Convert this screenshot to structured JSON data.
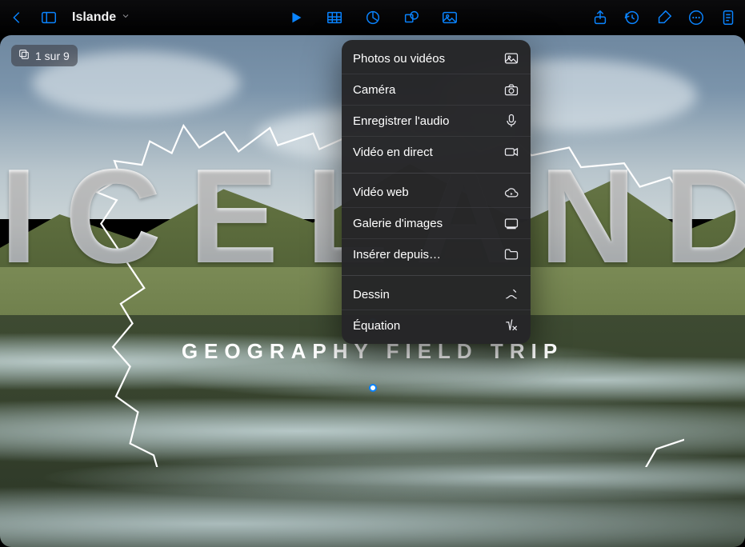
{
  "header": {
    "doc_title": "Islande"
  },
  "badge": {
    "label": "1 sur 9"
  },
  "slide": {
    "title": "ICELAND",
    "subtitle": "GEOGRAPHY FIELD TRIP"
  },
  "menu": {
    "group1": [
      {
        "label": "Photos ou vidéos",
        "icon": "photos-icon"
      },
      {
        "label": "Caméra",
        "icon": "camera-icon"
      },
      {
        "label": "Enregistrer l'audio",
        "icon": "microphone-icon"
      },
      {
        "label": "Vidéo en direct",
        "icon": "live-video-icon"
      }
    ],
    "group2": [
      {
        "label": "Vidéo web",
        "icon": "cloud-icon"
      },
      {
        "label": "Galerie d'images",
        "icon": "gallery-icon"
      },
      {
        "label": "Insérer depuis…",
        "icon": "folder-icon"
      }
    ],
    "group3": [
      {
        "label": "Dessin",
        "icon": "draw-icon"
      },
      {
        "label": "Équation",
        "icon": "equation-icon"
      }
    ]
  }
}
